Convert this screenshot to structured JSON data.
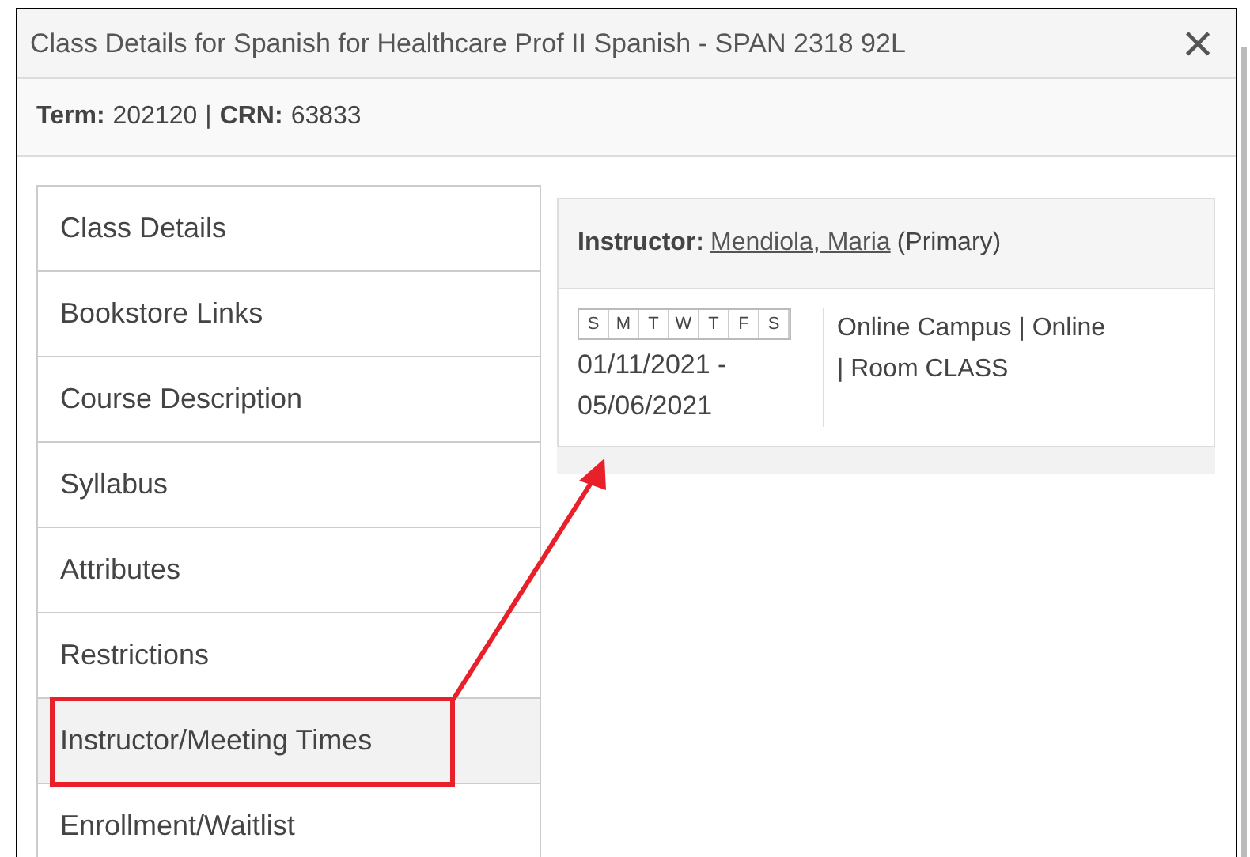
{
  "window": {
    "title": "Class Details for Spanish for Healthcare Prof II Spanish - SPAN 2318 92L",
    "close": "×"
  },
  "subheader": {
    "term_label": "Term:",
    "term": "202120",
    "separator": "|",
    "crn_label": "CRN:",
    "crn": "63833"
  },
  "sidebar": {
    "items": [
      {
        "label": "Class Details",
        "selected": false
      },
      {
        "label": "Bookstore Links",
        "selected": false
      },
      {
        "label": "Course Description",
        "selected": false
      },
      {
        "label": "Syllabus",
        "selected": false
      },
      {
        "label": "Attributes",
        "selected": false
      },
      {
        "label": "Restrictions",
        "selected": false
      },
      {
        "label": "Instructor/Meeting Times",
        "selected": true
      },
      {
        "label": "Enrollment/Waitlist",
        "selected": false
      }
    ]
  },
  "meeting": {
    "instructor_label": "Instructor:",
    "instructor": "Mendiola, Maria",
    "role": "(Primary)",
    "days": [
      {
        "label": "S",
        "selected": false
      },
      {
        "label": "M",
        "selected": false
      },
      {
        "label": "T",
        "selected": false
      },
      {
        "label": "W",
        "selected": false
      },
      {
        "label": "T",
        "selected": false
      },
      {
        "label": "F",
        "selected": false
      },
      {
        "label": "S",
        "selected": false
      }
    ],
    "dates": "01/11/2021 - 05/06/2021",
    "location": "Online Campus | Online | Room CLASS"
  }
}
